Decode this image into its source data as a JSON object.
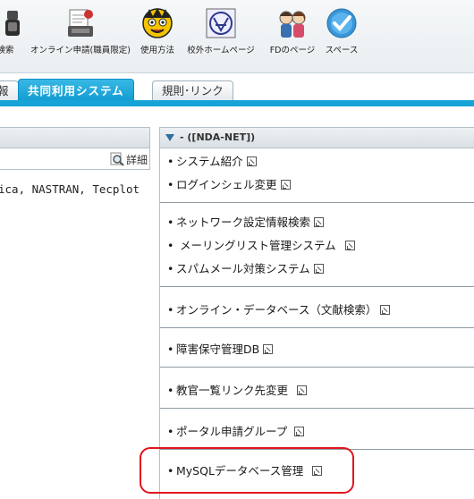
{
  "toolbar": {
    "items": [
      {
        "label": "検索",
        "icon": "search-binoculars-icon"
      },
      {
        "label": "オンライン申請(職員限定)",
        "icon": "application-form-icon"
      },
      {
        "label": "使用方法",
        "icon": "manual-character-icon"
      },
      {
        "label": "校外ホームページ",
        "icon": "school-emblem-icon"
      },
      {
        "label": "FDのページ",
        "icon": "people-icon"
      },
      {
        "label": "スペース",
        "icon": "check-circle-icon"
      }
    ]
  },
  "tabs": [
    {
      "label": "報",
      "active": false
    },
    {
      "label": "共同利用システム",
      "active": true
    },
    {
      "label": "規則･リンク",
      "active": false
    }
  ],
  "left_panel": {
    "detail_label": "詳細",
    "text": "ica, NASTRAN, Tecplot"
  },
  "right_panel": {
    "title": "- ([NDA-NET])",
    "groups": [
      {
        "items": [
          "システム紹介",
          "ログインシェル変更"
        ]
      },
      {
        "items": [
          "ネットワーク設定情報検索",
          " メーリングリスト管理システム",
          "スパムメール対策システム"
        ]
      },
      {
        "items": [
          "オンライン・データベース（文献検索）"
        ]
      },
      {
        "items": [
          "障害保守管理DB"
        ]
      },
      {
        "items": [
          "教官一覧リンク先変更"
        ]
      },
      {
        "items": [
          "ポータル申請グループ"
        ]
      },
      {
        "items": [
          "MySQLデータベース管理"
        ]
      }
    ]
  },
  "colors": {
    "tab_active": "#16a3d8",
    "highlight": "#e0141e"
  }
}
